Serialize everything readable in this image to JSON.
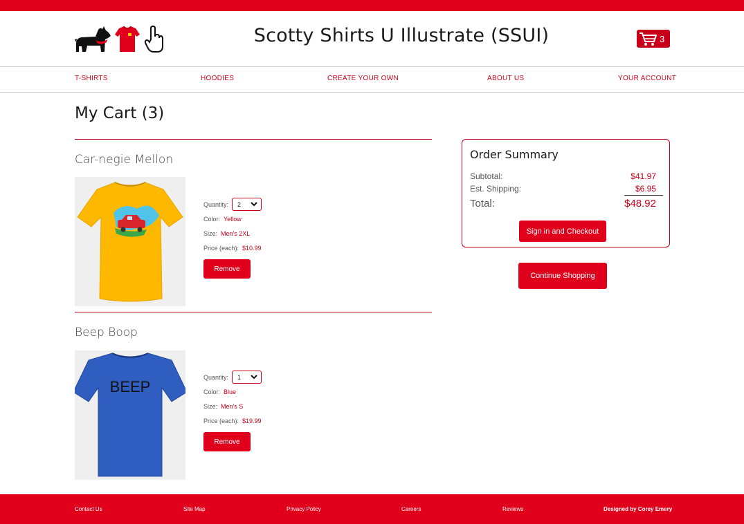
{
  "header": {
    "title": "Scotty Shirts U Illustrate (SSUI)",
    "cart_count": "3",
    "logo_icons": [
      "scottie-dog-icon",
      "red-shirt-icon",
      "pointer-hand-icon"
    ]
  },
  "nav": {
    "items": [
      "T-SHIRTS",
      "HOODIES",
      "CREATE YOUR OWN",
      "ABOUT US",
      "YOUR ACCOUNT"
    ]
  },
  "page": {
    "title": "My Cart (3)"
  },
  "cart": {
    "items": [
      {
        "name": "Car-negie Mellon",
        "quantity_label": "Quantity:",
        "quantity": "2",
        "color_label": "Color:",
        "color": "Yellow",
        "size_label": "Size:",
        "size": "Men's 2XL",
        "price_label": "Price (each):",
        "price": "$10.99",
        "remove_label": "Remove",
        "shirt_color": "#ffb800"
      },
      {
        "name": "Beep Boop",
        "quantity_label": "Quantity:",
        "quantity": "1",
        "color_label": "Color:",
        "color": "Blue",
        "size_label": "Size:",
        "size": "Men's S",
        "price_label": "Price (each):",
        "price": "$19.99",
        "remove_label": "Remove",
        "shirt_color": "#2f5dc0",
        "shirt_text": "BEEP"
      }
    ]
  },
  "summary": {
    "title": "Order Summary",
    "subtotal_label": "Subtotal:",
    "subtotal": "$41.97",
    "shipping_label": "Est. Shipping:",
    "shipping": "$6.95",
    "total_label": "Total:",
    "total": "$48.92",
    "checkout_label": "Sign in and Checkout",
    "continue_label": "Continue Shopping"
  },
  "footer": {
    "links": [
      "Contact Us",
      "Site Map",
      "Privacy Policy",
      "Careers",
      "Reviews"
    ],
    "credit": "Designed by Corey Emery"
  },
  "colors": {
    "brand_red": "#e0001b",
    "accent_red": "#c8001a"
  }
}
